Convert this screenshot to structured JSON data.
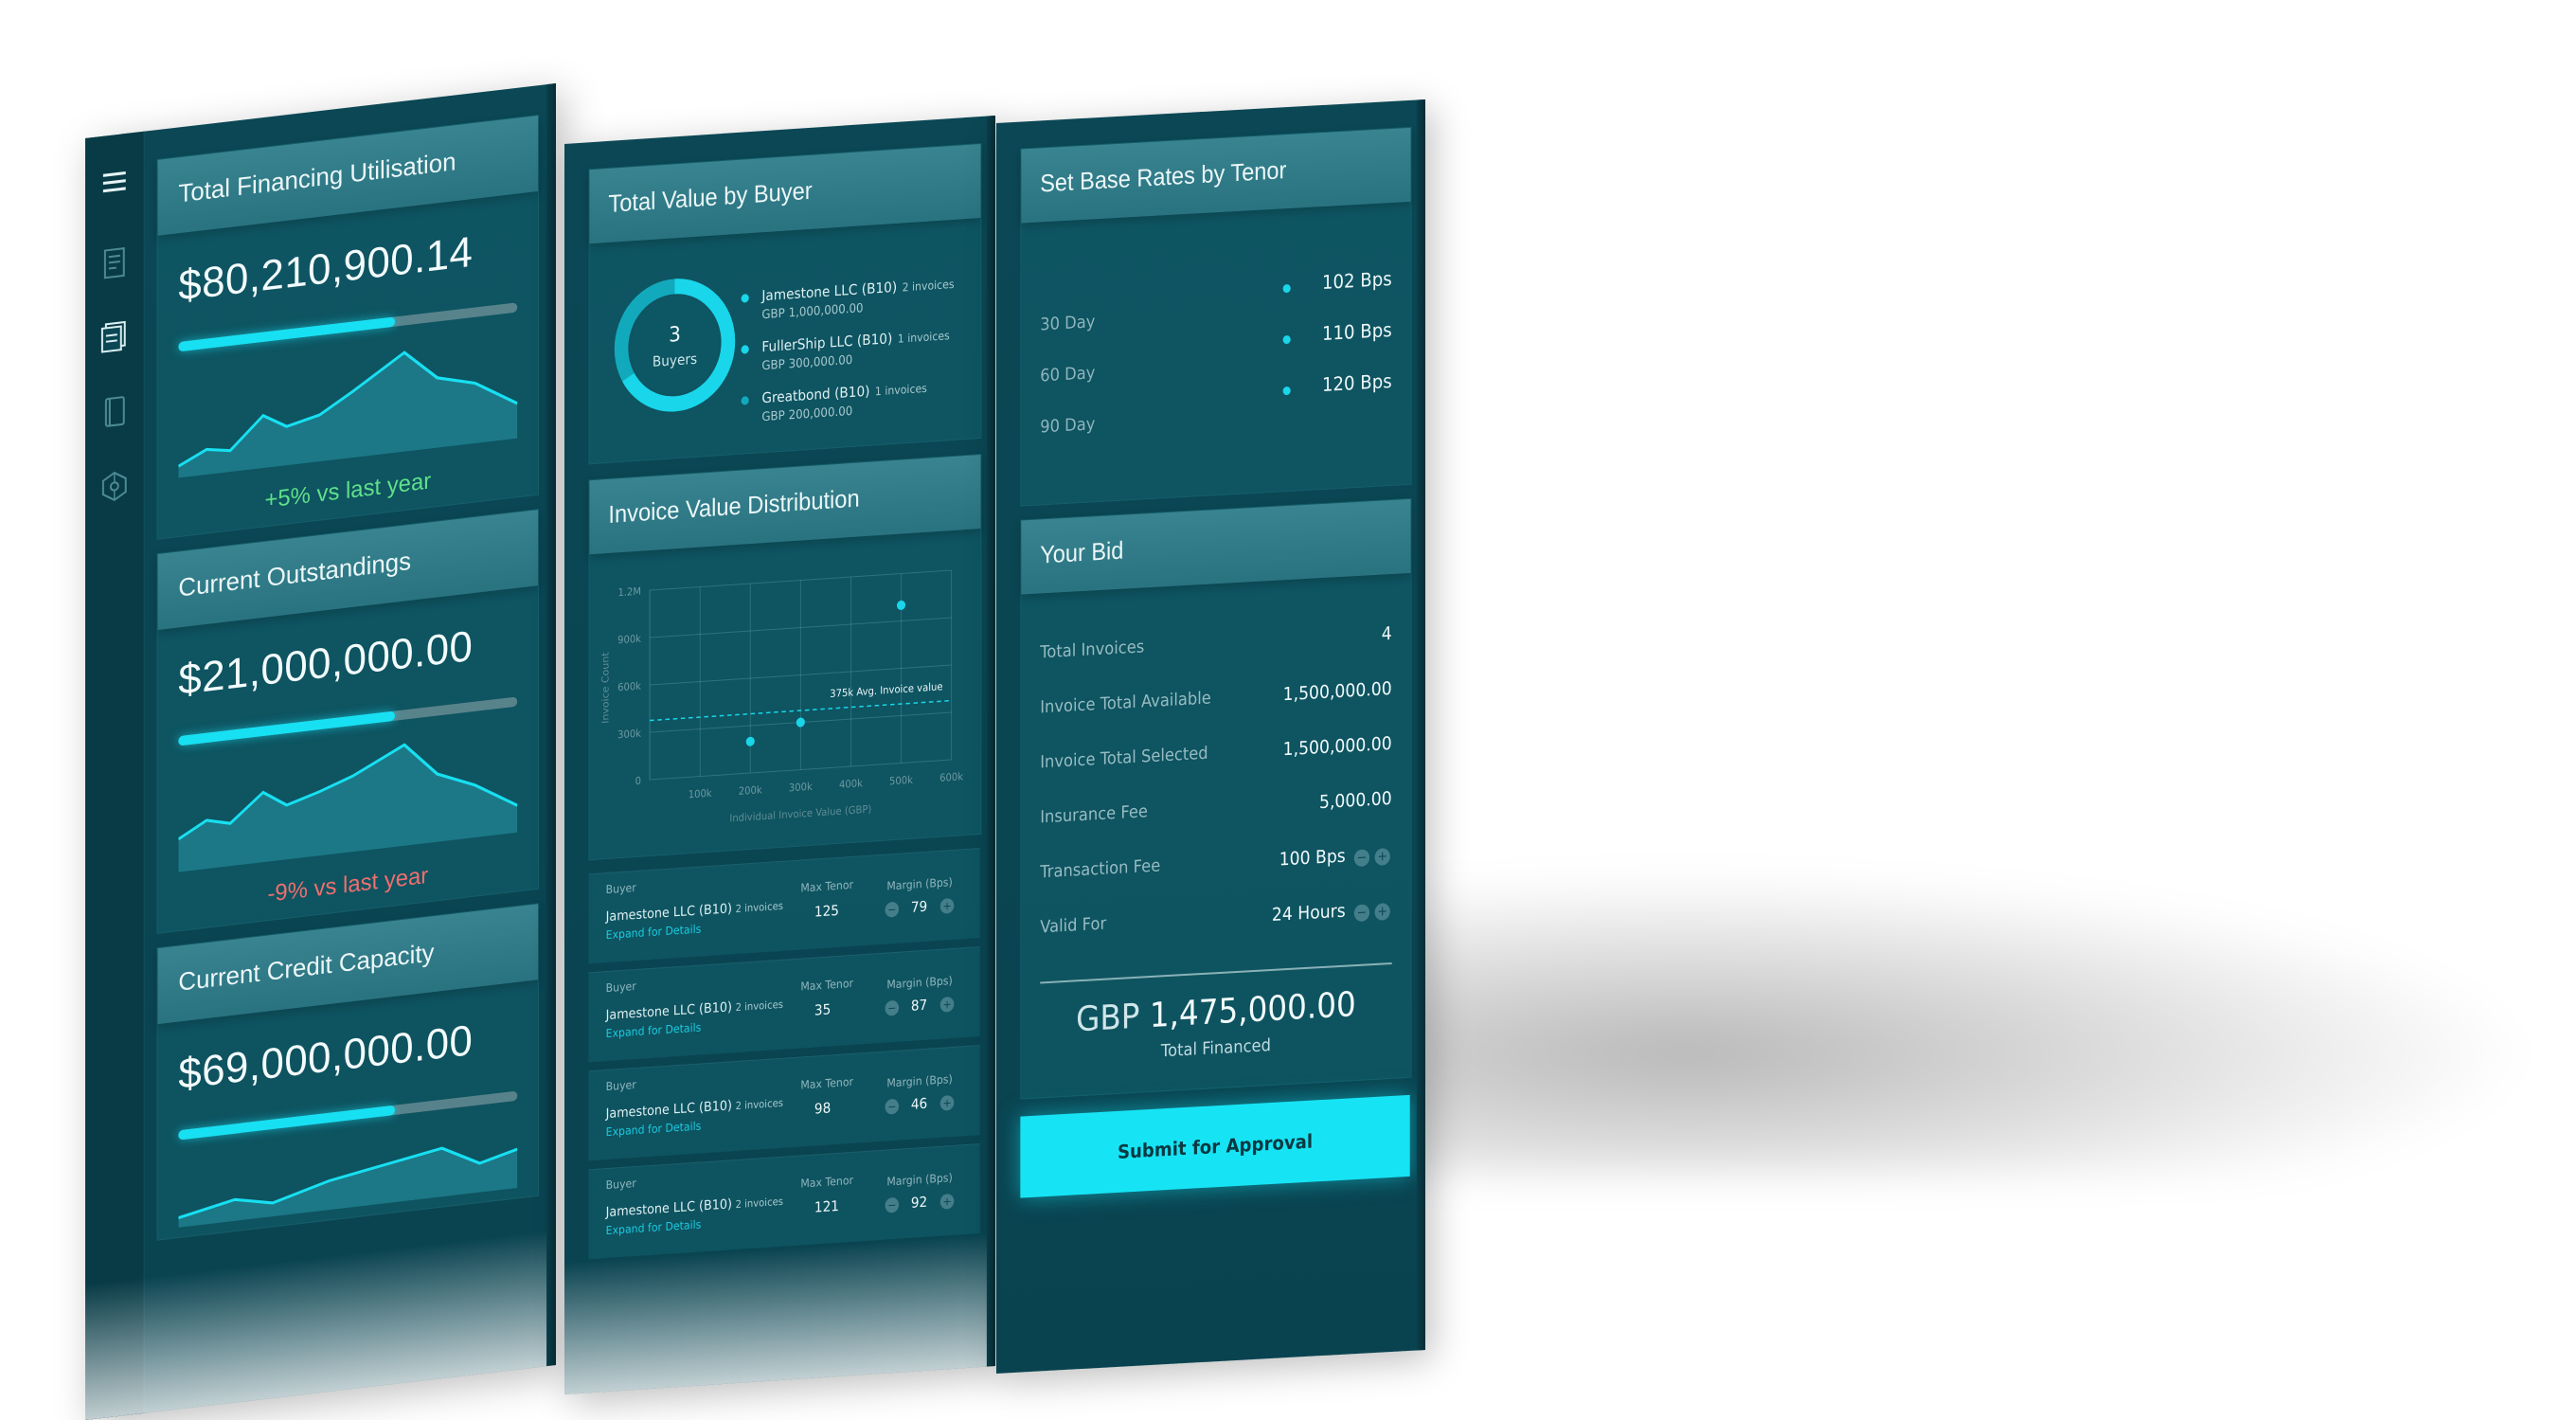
{
  "colors": {
    "accent": "#17e0f2",
    "positive": "#5fe08a",
    "negative": "#f06f6f",
    "panel": "#0b4754",
    "card_header": "#3f8c98"
  },
  "sidebar": {
    "icons": [
      "menu-icon",
      "document-icon",
      "receipt-stack-icon",
      "notebook-icon",
      "network-icon"
    ]
  },
  "panel1": {
    "utilisation": {
      "title": "Total Financing Utilisation",
      "value": "$80,210,900.14",
      "progress": 0.64,
      "delta": "+5% vs last year"
    },
    "outstandings": {
      "title": "Current Outstandings",
      "value": "$21,000,000.00",
      "progress": 0.64,
      "delta": "-9% vs last year"
    },
    "capacity": {
      "title": "Current Credit Capacity",
      "value": "$69,000,000.00",
      "progress": 0.64
    }
  },
  "panel2": {
    "buyers": {
      "title": "Total Value by Buyer",
      "donut_count": "3",
      "donut_label": "Buyers",
      "legend": [
        {
          "name": "Jamestone LLC (B10)",
          "invoices": "2 invoices",
          "amount": "GBP 1,000,000.00"
        },
        {
          "name": "FullerShip LLC (B10)",
          "invoices": "1 invoices",
          "amount": "GBP 300,000.00"
        },
        {
          "name": "Greatbond (B10)",
          "invoices": "1 invoices",
          "amount": "GBP 200,000.00"
        }
      ]
    },
    "distribution": {
      "title": "Invoice Value Distribution",
      "avg_label": "375k Avg. Invoice value",
      "chart_data": {
        "type": "scatter",
        "title": "Invoice Value Distribution",
        "xlabel": "Individual Invoice Value (GBP)",
        "ylabel": "Invoice Count",
        "x_ticks": [
          "100k",
          "200k",
          "300k",
          "400k",
          "500k",
          "600k"
        ],
        "y_ticks": [
          "0",
          "300k",
          "600k",
          "900k",
          "1.2M"
        ],
        "xlim": [
          0,
          600000
        ],
        "ylim": [
          0,
          1200000
        ],
        "points": [
          {
            "x": 200000,
            "y": 200000
          },
          {
            "x": 300000,
            "y": 300000
          },
          {
            "x": 500000,
            "y": 1000000
          }
        ],
        "reference_line": {
          "y": 375000,
          "label": "375k Avg. Invoice value"
        },
        "grid": true
      }
    },
    "labels": {
      "buyer": "Buyer",
      "max_tenor": "Max Tenor",
      "margin": "Margin (Bps)",
      "expand": "Expand for Details"
    },
    "rows": [
      {
        "name": "Jamestone LLC (B10)",
        "invoices": "2 invoices",
        "max_tenor": "125",
        "margin": "79"
      },
      {
        "name": "Jamestone LLC (B10)",
        "invoices": "2 invoices",
        "max_tenor": "35",
        "margin": "87"
      },
      {
        "name": "Jamestone LLC (B10)",
        "invoices": "2 invoices",
        "max_tenor": "98",
        "margin": "46"
      },
      {
        "name": "Jamestone LLC (B10)",
        "invoices": "2 invoices",
        "max_tenor": "121",
        "margin": "92"
      }
    ]
  },
  "panel3": {
    "rates": {
      "title": "Set Base Rates by Tenor",
      "items": [
        {
          "label": "30 Day",
          "value": "102 Bps"
        },
        {
          "label": "60 Day",
          "value": "110 Bps"
        },
        {
          "label": "90 Day",
          "value": "120 Bps"
        }
      ]
    },
    "bid": {
      "title": "Your Bid",
      "rows": [
        {
          "label": "Total Invoices",
          "value": "4"
        },
        {
          "label": "Invoice Total Available",
          "value": "1,500,000.00"
        },
        {
          "label": "Invoice Total Selected",
          "value": "1,500,000.00"
        },
        {
          "label": "Insurance Fee",
          "value": "5,000.00"
        },
        {
          "label": "Transaction Fee",
          "value": "100 Bps"
        },
        {
          "label": "Valid For",
          "value": "24 Hours"
        }
      ],
      "total_currency": "GBP",
      "total_value": "1,475,000.00",
      "total_label": "Total Financed",
      "submit_label": "Submit for Approval"
    }
  }
}
